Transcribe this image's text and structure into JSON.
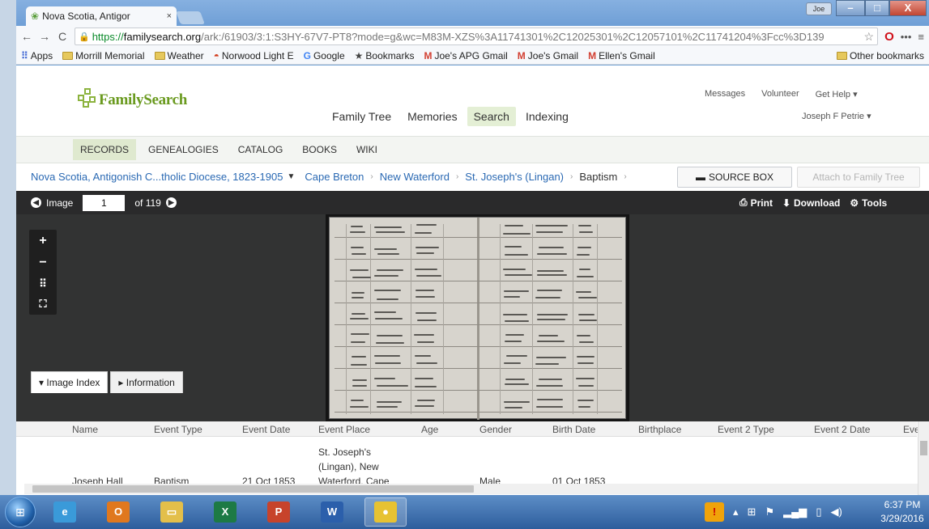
{
  "browser": {
    "tab_title": "Nova Scotia, Antigor",
    "tab_close": "×",
    "user_badge": "Joe",
    "win_min": "–",
    "win_max": "□",
    "win_close": "X",
    "url_https": "https://",
    "url_domain": "familysearch.org",
    "url_path": "/ark:/61903/3:1:S3HY-67V7-PT8?mode=g&wc=M83M-XZS%3A11741301%2C12025301%2C12057101%2C11741204%3Fcc%3D139",
    "bookmarks": [
      {
        "label": "Apps",
        "icon": "apps-grid-icon"
      },
      {
        "label": "Morrill Memorial",
        "icon": "folder-icon"
      },
      {
        "label": "Weather",
        "icon": "folder-icon"
      },
      {
        "label": "Norwood Light E",
        "icon": "norwood-icon"
      },
      {
        "label": "Google",
        "icon": "google-icon"
      },
      {
        "label": "Bookmarks",
        "icon": "star-icon"
      },
      {
        "label": "Joe's APG Gmail",
        "icon": "gmail-icon"
      },
      {
        "label": "Joe's Gmail",
        "icon": "gmail-icon"
      },
      {
        "label": "Ellen's Gmail",
        "icon": "gmail-icon"
      }
    ],
    "other_bookmarks": "Other bookmarks"
  },
  "site": {
    "logo_text": "FamilySearch",
    "main_nav": [
      "Family Tree",
      "Memories",
      "Search",
      "Indexing"
    ],
    "active_nav": "Search",
    "top_links": [
      "Messages",
      "Volunteer",
      "Get Help ▾"
    ],
    "user_name": "Joseph F Petrie ▾",
    "sub_nav": [
      "RECORDS",
      "GENEALOGIES",
      "CATALOG",
      "BOOKS",
      "WIKI"
    ],
    "active_sub": "RECORDS"
  },
  "breadcrumb": {
    "collection": "Nova Scotia, Antigonish C...tholic Diocese, 1823-1905",
    "items": [
      "Cape Breton",
      "New Waterford",
      "St. Joseph's (Lingan)"
    ],
    "current": "Baptism",
    "source_box": "SOURCE BOX",
    "attach": "Attach to Family Tree"
  },
  "viewer": {
    "image_label": "Image",
    "image_number": "1",
    "of_total": "of 119",
    "print": "Print",
    "download": "Download",
    "tools": "Tools",
    "zoom_in": "+",
    "zoom_out": "−",
    "grid": "⠿",
    "fullscreen": "⛶"
  },
  "index_tabs": {
    "image_index": "▾ Image Index",
    "information": "▸ Information"
  },
  "table": {
    "headers": [
      "Name",
      "Event Type",
      "Event Date",
      "Event Place",
      "Age",
      "Gender",
      "Birth Date",
      "Birthplace",
      "Event 2 Type",
      "Event 2 Date",
      "Ever"
    ],
    "row": {
      "name": "Joseph Hall",
      "event_type": "Baptism",
      "event_date": "21 Oct 1853",
      "place_1": "St. Joseph's",
      "place_2": "(Lingan), New",
      "place_3": "Waterford, Cape",
      "gender": "Male",
      "birth_date": "01 Oct 1853"
    }
  },
  "taskbar": {
    "time": "6:37 PM",
    "date": "3/29/2016",
    "apps": [
      {
        "name": "ie-icon",
        "glyph": "e",
        "color": "#3a9ad9"
      },
      {
        "name": "outlook-icon",
        "glyph": "O",
        "color": "#e0781e"
      },
      {
        "name": "explorer-icon",
        "glyph": "▭",
        "color": "#e3bf4a"
      },
      {
        "name": "excel-icon",
        "glyph": "X",
        "color": "#1d7a45"
      },
      {
        "name": "powerpoint-icon",
        "glyph": "P",
        "color": "#c7432b"
      },
      {
        "name": "word-icon",
        "glyph": "W",
        "color": "#2b5fab"
      },
      {
        "name": "chrome-icon",
        "glyph": "●",
        "color": "#e7c232"
      }
    ]
  }
}
